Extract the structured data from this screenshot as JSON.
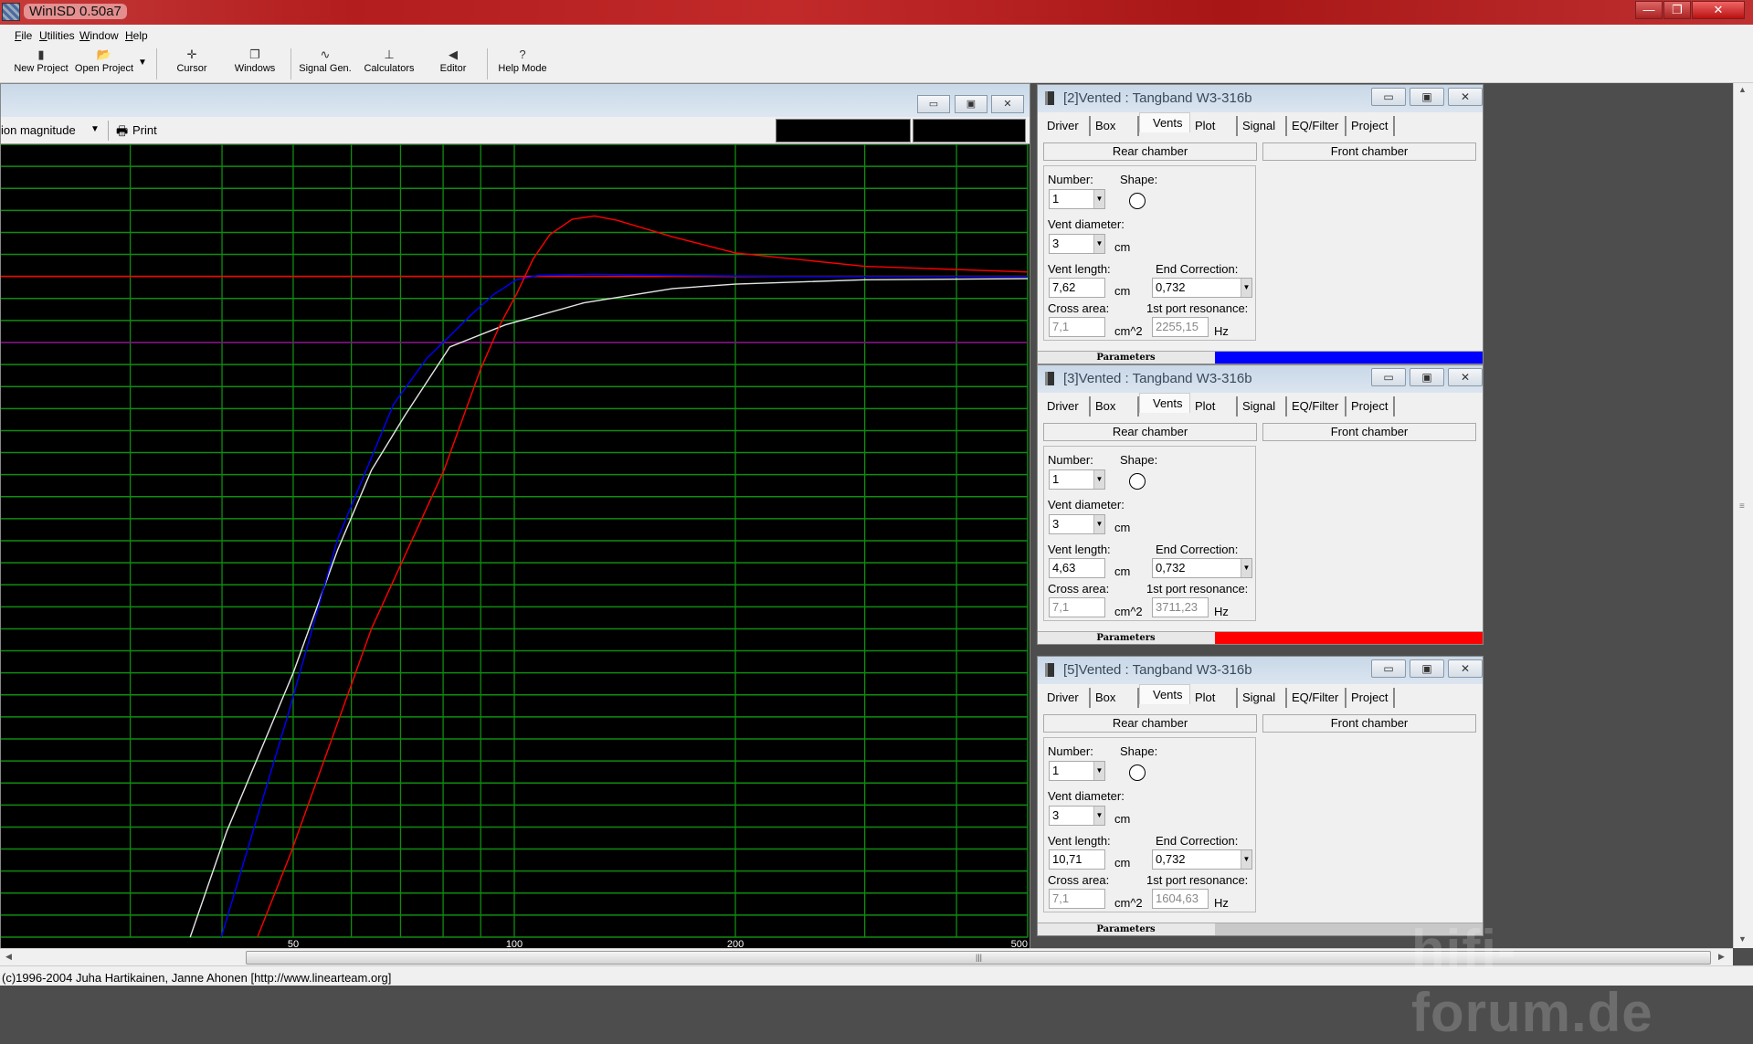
{
  "app": {
    "title": "WinISD 0.50a7",
    "window_buttons": [
      "—",
      "❐",
      "✕"
    ]
  },
  "menu": [
    "File",
    "Utilities",
    "Window",
    "Help"
  ],
  "toolbar": [
    {
      "label": "New Project",
      "icon": "▮"
    },
    {
      "label": "Open Project",
      "icon": "📂"
    },
    {
      "label": "Cursor",
      "icon": "✛"
    },
    {
      "label": "Windows",
      "icon": "❐"
    },
    {
      "label": "Signal Gen.",
      "icon": "∿"
    },
    {
      "label": "Calculators",
      "icon": "⊥"
    },
    {
      "label": "Editor",
      "icon": "◀"
    },
    {
      "label": "Help Mode",
      "icon": "?"
    }
  ],
  "plot_window": {
    "view_label": "ion magnitude",
    "print_label": "Print",
    "buttons": [
      "▭",
      "▣",
      "✕"
    ]
  },
  "chart_data": {
    "type": "line",
    "x_scale": "log",
    "xlim": [
      20,
      500
    ],
    "ylim": [
      -30,
      6
    ],
    "x_tick_labels": [
      "50",
      "100",
      "200",
      "500"
    ],
    "x_gridlines": [
      30,
      40,
      50,
      60,
      70,
      80,
      90,
      100,
      200,
      300,
      400
    ],
    "y_grid_step": 1,
    "grid": true,
    "grid_color": "#108c10",
    "background": "#000000",
    "reference_lines": [
      {
        "y": 0,
        "color": "#ff0000"
      },
      {
        "y": -3,
        "color": "#8b008b"
      }
    ],
    "series": [
      {
        "color": "#e6e6e6",
        "x": [
          36.2,
          40.6,
          50,
          57.5,
          63.9,
          71,
          81.7,
          97.2,
          124.3,
          164.3,
          200,
          300,
          500
        ],
        "y": [
          -30,
          -25.2,
          -18,
          -12.4,
          -8.8,
          -6.3,
          -3.2,
          -2.2,
          -1.2,
          -0.55,
          -0.35,
          -0.15,
          -0.1
        ]
      },
      {
        "color": "#0000ff",
        "x": [
          39.9,
          49.1,
          57.5,
          68.5,
          76.1,
          81.7,
          87.6,
          93.9,
          100.7,
          108,
          128.6,
          164,
          233,
          500
        ],
        "y": [
          -30,
          -20,
          -11.9,
          -5.8,
          -3.7,
          -2.7,
          -1.7,
          -0.8,
          -0.15,
          0.05,
          0.1,
          0.05,
          0,
          0
        ]
      },
      {
        "color": "#ff0000",
        "x": [
          44.7,
          49.6,
          63.9,
          80.2,
          90,
          95.6,
          100.7,
          106.1,
          111.8,
          119.9,
          128.6,
          138,
          164.3,
          200,
          300,
          500
        ],
        "y": [
          -30,
          -26.2,
          -16,
          -8.8,
          -4.2,
          -2.2,
          -0.8,
          0.8,
          1.9,
          2.6,
          2.75,
          2.55,
          1.8,
          1.07,
          0.46,
          0.2
        ]
      }
    ]
  },
  "panel_labels": {
    "tabs": [
      "Driver",
      "Box",
      "Vents",
      "Plot",
      "Signal",
      "EQ/Filter",
      "Project"
    ],
    "active_tab": "Vents",
    "rear": "Rear chamber",
    "front": "Front chamber",
    "number": "Number:",
    "shape": "Shape:",
    "vent_diameter": "Vent diameter:",
    "vent_length": "Vent length:",
    "end_correction": "End Correction:",
    "cross_area": "Cross area:",
    "port_resonance": "1st port resonance:",
    "cm": "cm",
    "cm2": "cm^2",
    "hz": "Hz",
    "parameters": "Parameters",
    "buttons": [
      "▭",
      "▣",
      "✕"
    ]
  },
  "panels": [
    {
      "title": "[2]Vented : Tangband W3-316b",
      "number": "1",
      "vent_diameter": "3",
      "vent_length": "7,62",
      "end_correction": "0,732",
      "cross_area": "7,1",
      "port_resonance": "2255,15",
      "color": "#0000ff"
    },
    {
      "title": "[3]Vented : Tangband W3-316b",
      "number": "1",
      "vent_diameter": "3",
      "vent_length": "4,63",
      "end_correction": "0,732",
      "cross_area": "7,1",
      "port_resonance": "3711,23",
      "color": "#ff0000"
    },
    {
      "title": "[5]Vented : Tangband W3-316b",
      "number": "1",
      "vent_diameter": "3",
      "vent_length": "10,71",
      "end_correction": "0,732",
      "cross_area": "7,1",
      "port_resonance": "1604,63",
      "color": "#c8c8c8"
    }
  ],
  "status": {
    "text": "(c)1996-2004 Juha Hartikainen, Janne Ahonen [http://www.linearteam.org]"
  },
  "watermark": "hifi-forum.de"
}
